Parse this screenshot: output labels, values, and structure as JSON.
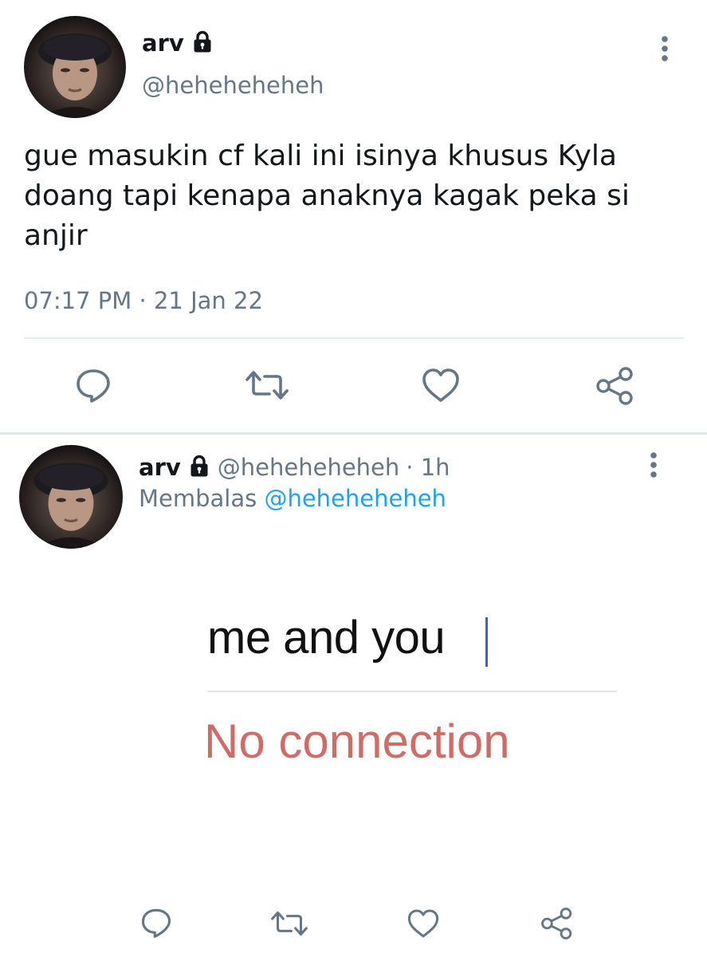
{
  "tweet": {
    "author_name": "arv",
    "author_handle": "@heheheheheh",
    "text": "gue masukin cf kali ini isinya khusus Kyla doang tapi kenapa anaknya kagak peka si anjir",
    "timestamp": "07:17 PM · 21 Jan 22",
    "protected_icon": "lock-icon",
    "actions": [
      "reply-icon",
      "retweet-icon",
      "like-icon",
      "share-icon"
    ]
  },
  "reply": {
    "author_name": "arv",
    "author_handle": "@heheheheheh",
    "time_ago": "· 1h",
    "replying_prefix": "Membalas",
    "replying_to": "@heheheheheh",
    "protected_icon": "lock-icon",
    "embedded_image": {
      "input_text": "me and you",
      "error_text": "No connection"
    },
    "actions": [
      "reply-icon",
      "retweet-icon",
      "like-icon",
      "share-icon"
    ]
  },
  "colors": {
    "primary_text": "#14171a",
    "secondary_text": "#657786",
    "link": "#1da1f2",
    "divider": "#e6ecf0",
    "error_text": "#cf6c68",
    "caret": "#3d62c4"
  }
}
